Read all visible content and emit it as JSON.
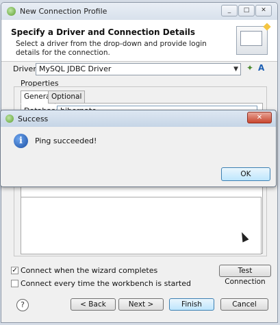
{
  "window": {
    "title": "New Connection Profile",
    "controls": [
      "_",
      "□",
      "✕"
    ]
  },
  "header": {
    "title": "Specify a Driver and Connection Details",
    "description": "Select a driver from the drop-down and provide login details for the connection."
  },
  "drivers": {
    "label": "Drivers:",
    "selected": "MySQL JDBC Driver"
  },
  "properties": {
    "label": "Properties",
    "tabs": [
      "General",
      "Optional"
    ],
    "database_label": "Database:",
    "database_value": "hibernate"
  },
  "options": {
    "connect_on_complete": "Connect when the wizard completes",
    "connect_on_complete_checked": true,
    "connect_on_start": "Connect every time the workbench is started",
    "connect_on_start_checked": false
  },
  "buttons": {
    "test": "Test Connection",
    "back": "< Back",
    "next": "Next >",
    "finish": "Finish",
    "cancel": "Cancel",
    "help": "?"
  },
  "dialog": {
    "title": "Success",
    "message": "Ping succeeded!",
    "ok": "OK",
    "close": "✕"
  }
}
